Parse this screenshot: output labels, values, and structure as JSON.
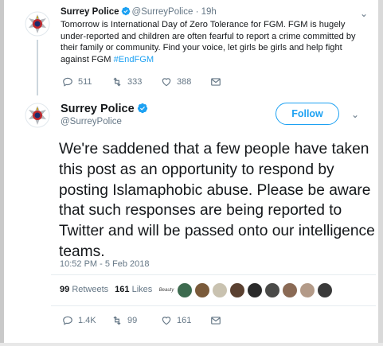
{
  "parent_tweet": {
    "display_name": "Surrey Police",
    "handle": "@SurreyPolice",
    "separator": "·",
    "time": "19h",
    "body_text": "Tomorrow is International Day of Zero Tolerance for FGM. FGM is hugely under-reported and children are often fearful to report a crime committed by their family or community. Find your voice, let girls be girls and help fight against FGM ",
    "hashtag": "#EndFGM",
    "reply_count": "511",
    "retweet_count": "333",
    "like_count": "388"
  },
  "main_tweet": {
    "display_name": "Surrey Police",
    "handle": "@SurreyPolice",
    "follow_label": "Follow",
    "text": "We're saddened that a few people have taken this post as an opportunity to respond by posting Islamaphobic abuse. Please be aware that such responses are being reported to Twitter and will be passed onto our intelligence teams.",
    "timestamp": "10:52 PM - 5 Feb 2018",
    "retweets_count": "99",
    "retweets_label": "Retweets",
    "likes_count": "161",
    "likes_label": "Likes",
    "reply_count": "1.4K",
    "retweet_count": "99",
    "like_count": "161"
  },
  "likers": [
    {
      "avatar": "liker-avatar",
      "label": "Beauty",
      "color": "#f3efe4"
    },
    {
      "avatar": "liker-avatar",
      "color": "#3d6b4f"
    },
    {
      "avatar": "liker-avatar",
      "color": "#7a5a3a"
    },
    {
      "avatar": "liker-avatar",
      "color": "#c9c2b0"
    },
    {
      "avatar": "liker-avatar",
      "color": "#5a4030"
    },
    {
      "avatar": "liker-avatar",
      "color": "#2a2a2a"
    },
    {
      "avatar": "liker-avatar",
      "color": "#4a4a48"
    },
    {
      "avatar": "liker-avatar",
      "color": "#8a6a55"
    },
    {
      "avatar": "liker-avatar",
      "color": "#b39a88"
    },
    {
      "avatar": "liker-avatar",
      "color": "#3a3a3a"
    }
  ],
  "colors": {
    "accent": "#1da1f2",
    "secondary_text": "#657786",
    "primary_text": "#14171a",
    "divider": "#e6ecf0"
  },
  "icons": {
    "verified": "verified-badge-icon",
    "caret": "chevron-down-icon",
    "reply": "reply-icon",
    "retweet": "retweet-icon",
    "like": "heart-icon",
    "dm": "envelope-icon",
    "avatar": "surrey-police-crest-icon"
  }
}
